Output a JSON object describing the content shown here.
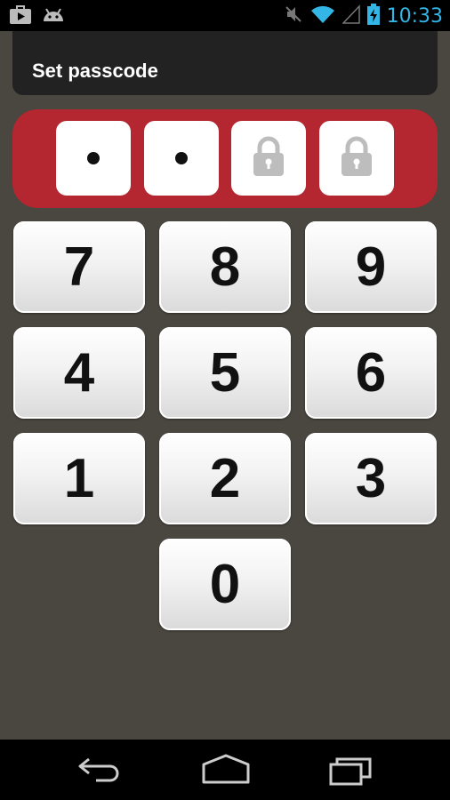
{
  "status_bar": {
    "time": "10:33",
    "accent_color": "#33b5e5",
    "left_icons": [
      "play-store-icon",
      "android-icon"
    ],
    "right_icons": [
      "mute-icon",
      "wifi-icon",
      "signal-icon",
      "battery-charging-icon"
    ]
  },
  "header": {
    "title": "Set passcode"
  },
  "passcode": {
    "bar_color": "#b42630",
    "slots": [
      {
        "state": "filled"
      },
      {
        "state": "filled"
      },
      {
        "state": "locked"
      },
      {
        "state": "locked"
      }
    ]
  },
  "keypad": {
    "keys": [
      "7",
      "8",
      "9",
      "4",
      "5",
      "6",
      "1",
      "2",
      "3",
      "0"
    ]
  },
  "nav_bar": {
    "buttons": [
      "back-icon",
      "home-icon",
      "recent-apps-icon"
    ]
  }
}
